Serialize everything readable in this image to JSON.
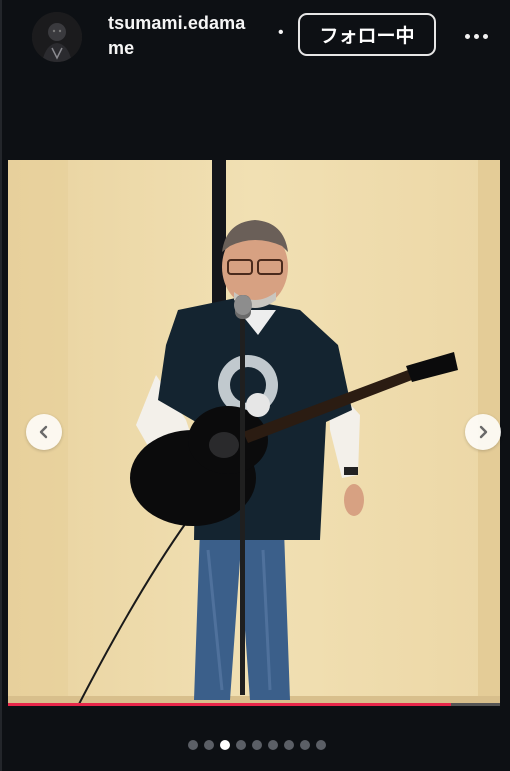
{
  "post": {
    "username": "tsumami.edamame",
    "username_line1": "tsumami.edama",
    "username_line2": "me",
    "separator": "•",
    "follow_label": "フォロー中"
  },
  "carousel": {
    "total_slides": 9,
    "active_index": 2,
    "progress_fraction": 0.9
  },
  "colors": {
    "background": "#0d1014",
    "progress": "#e8264a",
    "wall": "#eedcaa"
  },
  "icons": {
    "prev": "chevron-left-icon",
    "next": "chevron-right-icon",
    "more": "more-options-icon"
  }
}
